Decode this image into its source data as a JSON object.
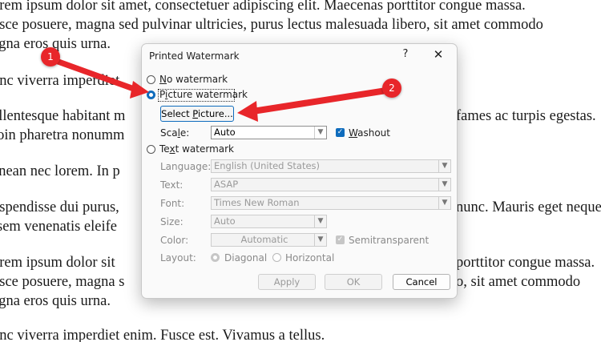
{
  "document": {
    "lines": [
      "orem ipsum dolor sit amet, consectetuer adipiscing elit. Maecenas porttitor congue massa.",
      "usce posuere, magna sed pulvinar ultricies, purus lectus malesuada libero, sit amet commodo",
      "agna eros quis urna.",
      "unc viverra imperdiet",
      "ellentesque habitant m",
      "fames ac turpis egestas.",
      "roin pharetra nonumm",
      "enean nec lorem. In p",
      "uspendisse dui purus,",
      "nunc. Mauris eget neque",
      "sem venenatis eleife",
      "orem ipsum dolor sit",
      "porttitor congue massa.",
      "usce posuere, magna s",
      "o, sit amet commodo",
      "agna eros quis urna.",
      "unc viverra imperdiet enim. Fusce est. Vivamus a tellus."
    ]
  },
  "dialog": {
    "title": "Printed Watermark",
    "help": "?",
    "close": "✕",
    "no_watermark_pre": "",
    "no_watermark_acc": "N",
    "no_watermark_post": "o watermark",
    "picture_pre": "P",
    "picture_acc": "i",
    "picture_post": "cture watermark",
    "select_picture_pre": "Select ",
    "select_picture_acc": "P",
    "select_picture_post": "icture...",
    "scale_pre": "Sca",
    "scale_acc": "l",
    "scale_post": "e:",
    "scale_value": "Auto",
    "washout_pre": "",
    "washout_acc": "W",
    "washout_post": "ashout",
    "text_pre": "Te",
    "text_acc": "x",
    "text_post": "t watermark",
    "language_label": "Language:",
    "language_value": "English (United States)",
    "text_label": "Text:",
    "text_value": "ASAP",
    "font_label": "Font:",
    "font_value": "Times New Roman",
    "size_label": "Size:",
    "size_value": "Auto",
    "color_label": "Color:",
    "color_value": "Automatic",
    "semitransparent": "Semitransparent",
    "layout_label": "Layout:",
    "diagonal": "Diagonal",
    "horizontal": "Horizontal",
    "apply": "Apply",
    "ok": "OK",
    "cancel": "Cancel"
  },
  "annotations": {
    "badge1": "1",
    "badge2": "2",
    "arrow_color": "#e8262a"
  },
  "colors": {
    "accent": "#0f6cbd",
    "annotation_red": "#e8262a"
  }
}
